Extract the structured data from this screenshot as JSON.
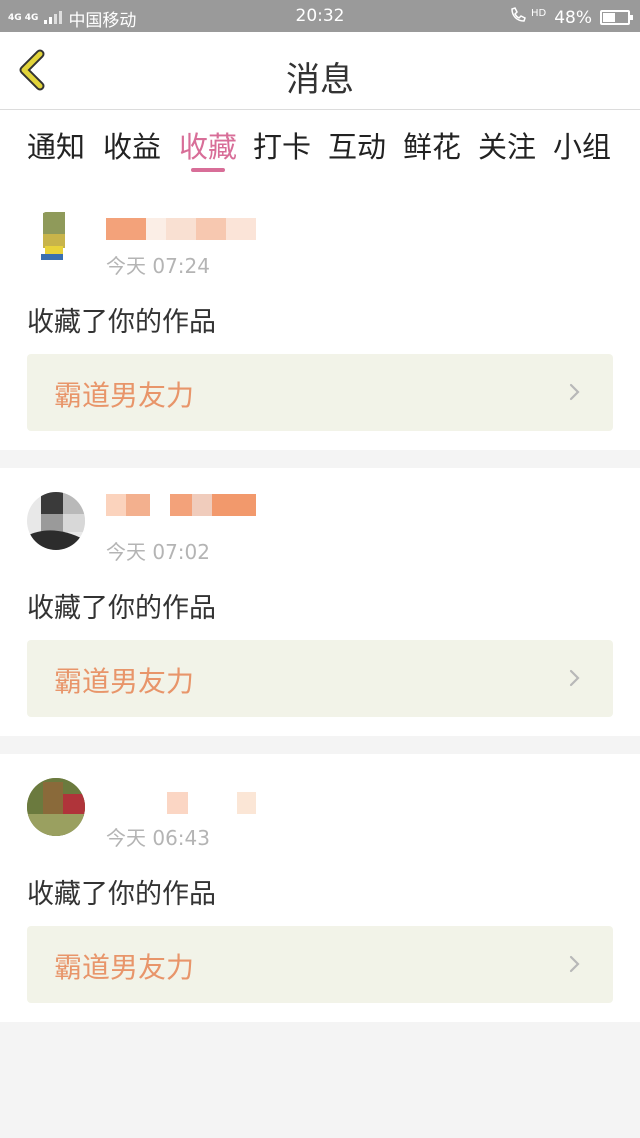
{
  "status_bar": {
    "network": "4G 4G",
    "carrier": "中国移动",
    "time": "20:32",
    "hd": "HD",
    "battery": "48%",
    "battery_level": 0.48
  },
  "header": {
    "title": "消息"
  },
  "tabs": [
    {
      "label": "通知"
    },
    {
      "label": "收益"
    },
    {
      "label": "收藏"
    },
    {
      "label": "打卡"
    },
    {
      "label": "互动"
    },
    {
      "label": "鲜花"
    },
    {
      "label": "关注"
    },
    {
      "label": "小组"
    }
  ],
  "active_tab": "收藏",
  "messages": [
    {
      "time": "今天 07:24",
      "action": "收藏了你的作品",
      "work_title": "霸道男友力"
    },
    {
      "time": "今天 07:02",
      "action": "收藏了你的作品",
      "work_title": "霸道男友力"
    },
    {
      "time": "今天 06:43",
      "action": "收藏了你的作品",
      "work_title": "霸道男友力"
    }
  ],
  "colors": {
    "accent": "#d86e98",
    "back_icon": "#e2d43a",
    "work_title": "#e8956a",
    "link_bg": "#f2f3e8"
  }
}
